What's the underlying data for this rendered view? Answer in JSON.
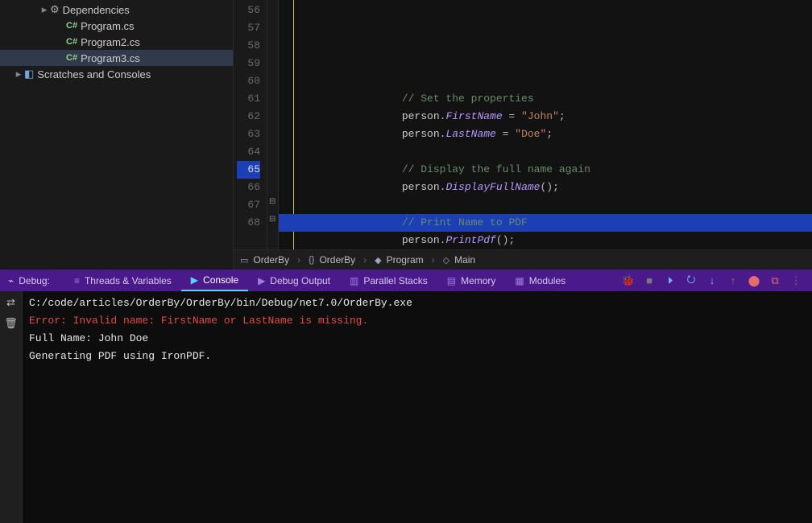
{
  "sidebar": {
    "items": [
      {
        "label": "Dependencies",
        "kind": "deps",
        "indent": 42,
        "arrow": "closed"
      },
      {
        "label": "Program.cs",
        "kind": "cs",
        "indent": 62,
        "arrow": "none"
      },
      {
        "label": "Program2.cs",
        "kind": "cs",
        "indent": 62,
        "arrow": "none"
      },
      {
        "label": "Program3.cs",
        "kind": "cs",
        "indent": 62,
        "arrow": "none",
        "selected": true
      },
      {
        "label": "Scratches and Consoles",
        "kind": "scratch",
        "indent": 10,
        "arrow": "closed"
      }
    ]
  },
  "editor": {
    "first_line_no": 56,
    "highlighted_line_no": 65,
    "lines": [
      {
        "n": 56,
        "segs": []
      },
      {
        "n": 57,
        "segs": []
      },
      {
        "n": 58,
        "segs": [
          [
            "                ",
            "id"
          ],
          [
            "// Set the properties",
            "comment"
          ]
        ]
      },
      {
        "n": 59,
        "segs": [
          [
            "                ",
            "id"
          ],
          [
            "person",
            "id"
          ],
          [
            ".",
            "punc"
          ],
          [
            "FirstName",
            "member"
          ],
          [
            " = ",
            "op"
          ],
          [
            "\"John\"",
            "str"
          ],
          [
            ";",
            "punc"
          ]
        ]
      },
      {
        "n": 60,
        "segs": [
          [
            "                ",
            "id"
          ],
          [
            "person",
            "id"
          ],
          [
            ".",
            "punc"
          ],
          [
            "LastName",
            "member"
          ],
          [
            " = ",
            "op"
          ],
          [
            "\"Doe\"",
            "str"
          ],
          [
            ";",
            "punc"
          ]
        ]
      },
      {
        "n": 61,
        "segs": []
      },
      {
        "n": 62,
        "segs": [
          [
            "                ",
            "id"
          ],
          [
            "// Display the full name again",
            "comment"
          ]
        ]
      },
      {
        "n": 63,
        "segs": [
          [
            "                ",
            "id"
          ],
          [
            "person",
            "id"
          ],
          [
            ".",
            "punc"
          ],
          [
            "DisplayFullName",
            "member"
          ],
          [
            "()",
            "punc"
          ],
          [
            ";",
            "punc"
          ]
        ]
      },
      {
        "n": 64,
        "segs": []
      },
      {
        "n": 65,
        "segs": [
          [
            "                ",
            "id"
          ],
          [
            "// Print Name to PDF",
            "comment"
          ]
        ]
      },
      {
        "n": 66,
        "segs": [
          [
            "                ",
            "id"
          ],
          [
            "person",
            "id"
          ],
          [
            ".",
            "punc"
          ],
          [
            "PrintPdf",
            "member"
          ],
          [
            "()",
            "punc"
          ],
          [
            ";",
            "punc"
          ]
        ]
      },
      {
        "n": 67,
        "segs": [
          [
            "            }",
            "punc"
          ]
        ]
      },
      {
        "n": 68,
        "segs": [
          [
            "        }",
            "punc"
          ]
        ]
      }
    ]
  },
  "breadcrumb": {
    "crumbs": [
      {
        "icon": "▭",
        "label": "OrderBy"
      },
      {
        "icon": "{}",
        "label": "OrderBy"
      },
      {
        "icon": "◆",
        "label": "Program"
      },
      {
        "icon": "◇",
        "label": "Main"
      }
    ]
  },
  "toolbar": {
    "debug_label": "Debug:",
    "tabs": [
      {
        "label": "Threads & Variables",
        "icon": "≡"
      },
      {
        "label": "Console",
        "icon": "▶",
        "active": true
      },
      {
        "label": "Debug Output",
        "icon": "▶"
      },
      {
        "label": "Parallel Stacks",
        "icon": "▥"
      },
      {
        "label": "Memory",
        "icon": "▤"
      },
      {
        "label": "Modules",
        "icon": "▦"
      }
    ],
    "right_icons": [
      {
        "name": "bug-icon",
        "glyph": "🐞",
        "cls": "green"
      },
      {
        "name": "stop-icon",
        "glyph": "■",
        "cls": "gray"
      },
      {
        "name": "resume-icon",
        "glyph": "⏵",
        "cls": "blue"
      },
      {
        "name": "step-over-icon",
        "glyph": "⭮",
        "cls": "blue"
      },
      {
        "name": "step-into-icon",
        "glyph": "↓",
        "cls": "blue"
      },
      {
        "name": "step-out-icon",
        "glyph": "↑",
        "cls": "gray"
      },
      {
        "name": "mute-breakpoints-icon",
        "glyph": "⬤",
        "cls": "red"
      },
      {
        "name": "view-breakpoints-icon",
        "glyph": "⧉",
        "cls": "red"
      },
      {
        "name": "more-icon",
        "glyph": "⋮",
        "cls": "gray"
      }
    ]
  },
  "side_buttons": [
    {
      "name": "layout-icon",
      "glyph": "⇄"
    },
    {
      "name": "trash-icon",
      "glyph": "🗑"
    }
  ],
  "console": {
    "lines": [
      {
        "text": "C:/code/articles/OrderBy/OrderBy/bin/Debug/net7.0/OrderBy.exe",
        "cls": ""
      },
      {
        "text": "Error: Invalid name: FirstName or LastName is missing.",
        "cls": "err"
      },
      {
        "text": "Full Name: John Doe",
        "cls": ""
      },
      {
        "text": "Generating PDF using IronPDF.",
        "cls": ""
      }
    ]
  }
}
